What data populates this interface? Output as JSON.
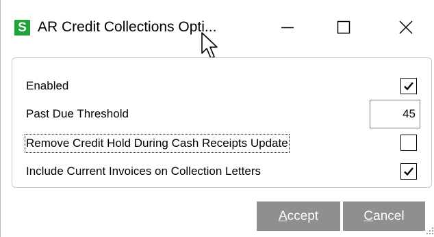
{
  "window": {
    "app_icon_letter": "S",
    "title": "AR Credit Collections Opti...",
    "controls": {
      "minimize": "minimize",
      "maximize": "maximize",
      "close": "close"
    }
  },
  "options": [
    {
      "label": "Enabled",
      "type": "checkbox",
      "checked": true
    },
    {
      "label": "Past Due Threshold",
      "type": "number",
      "value": "45"
    },
    {
      "label": "Remove Credit Hold During Cash Receipts Update",
      "type": "checkbox",
      "checked": false,
      "focused": true
    },
    {
      "label": "Include Current Invoices on Collection Letters",
      "type": "checkbox",
      "checked": true
    }
  ],
  "buttons": {
    "accept": {
      "mnemonic": "A",
      "rest": "ccept"
    },
    "cancel": {
      "mnemonic": "C",
      "rest": "ancel"
    }
  },
  "colors": {
    "app_icon": "#1fa33a",
    "button_bg": "#8f8f8f",
    "button_text": "#ffffff",
    "panel_border": "#c8c8c8"
  }
}
